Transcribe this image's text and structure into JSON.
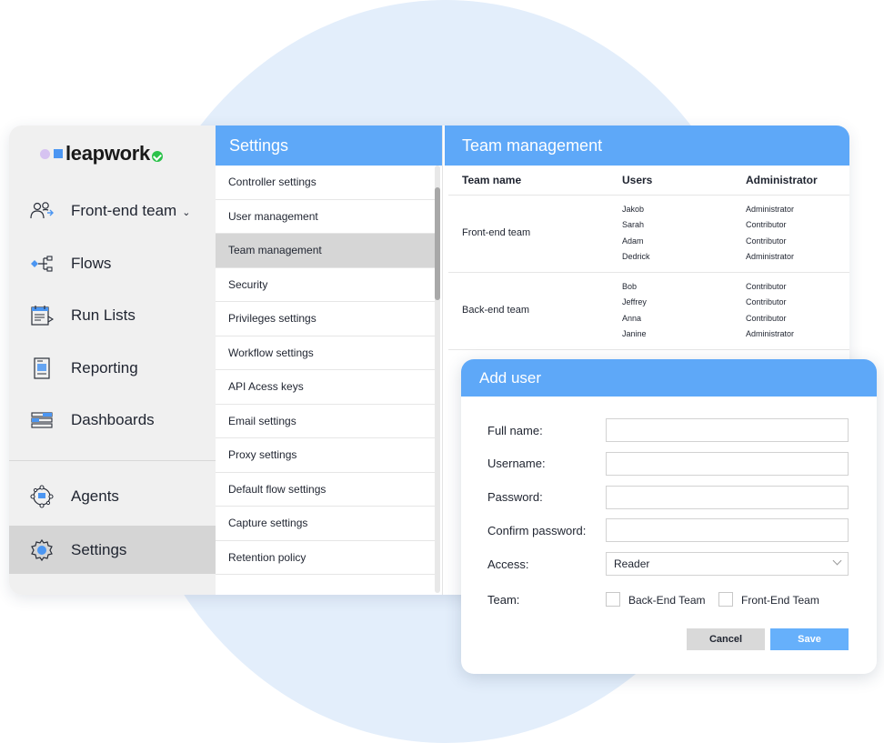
{
  "brand": {
    "name": "leapwork"
  },
  "sidebar": {
    "items": [
      {
        "label": "Front-end team",
        "icon": "team-icon",
        "has_dropdown": true
      },
      {
        "label": "Flows",
        "icon": "flows-icon"
      },
      {
        "label": "Run Lists",
        "icon": "run-lists-icon"
      },
      {
        "label": "Reporting",
        "icon": "reporting-icon"
      },
      {
        "label": "Dashboards",
        "icon": "dashboards-icon"
      },
      {
        "label": "Agents",
        "icon": "agents-icon"
      },
      {
        "label": "Settings",
        "icon": "settings-icon",
        "active": true
      }
    ]
  },
  "settings": {
    "title": "Settings",
    "items": [
      "Controller settings",
      "User management",
      "Team management",
      "Security",
      "Privileges settings",
      "Workflow settings",
      "API Acess keys",
      "Email settings",
      "Proxy settings",
      "Default flow settings",
      "Capture settings",
      "Retention policy"
    ],
    "active": "Team management"
  },
  "team_management": {
    "title": "Team management",
    "columns": [
      "Team name",
      "Users",
      "Administrator"
    ],
    "teams": [
      {
        "name": "Front-end team",
        "users": [
          "Jakob",
          "Sarah",
          "Adam",
          "Dedrick"
        ],
        "roles": [
          "Administrator",
          "Contributor",
          "Contributor",
          "Administrator"
        ]
      },
      {
        "name": "Back-end team",
        "users": [
          "Bob",
          "Jeffrey",
          "Anna",
          "Janine"
        ],
        "roles": [
          "Contributor",
          "Contributor",
          "Contributor",
          "Administrator"
        ]
      }
    ]
  },
  "add_user": {
    "title": "Add user",
    "full_name_label": "Full name:",
    "full_name_value": "",
    "username_label": "Username:",
    "username_value": "",
    "password_label": "Password:",
    "password_value": "",
    "confirm_password_label": "Confirm password:",
    "confirm_password_value": "",
    "access_label": "Access:",
    "access_value": "Reader",
    "team_label": "Team:",
    "team_options": [
      "Back-End Team",
      "Front-End Team"
    ],
    "cancel_label": "Cancel",
    "save_label": "Save"
  },
  "colors": {
    "header_blue": "#5ea8f8",
    "save_blue": "#66b0fb",
    "background_circle": "#e3eefb",
    "sidebar_bg": "#f0f0f0",
    "active_bg": "#d6d6d6",
    "logo_check": "#2bc24a",
    "logo_square": "#4b96f2",
    "logo_dot": "#d6c3f1"
  }
}
